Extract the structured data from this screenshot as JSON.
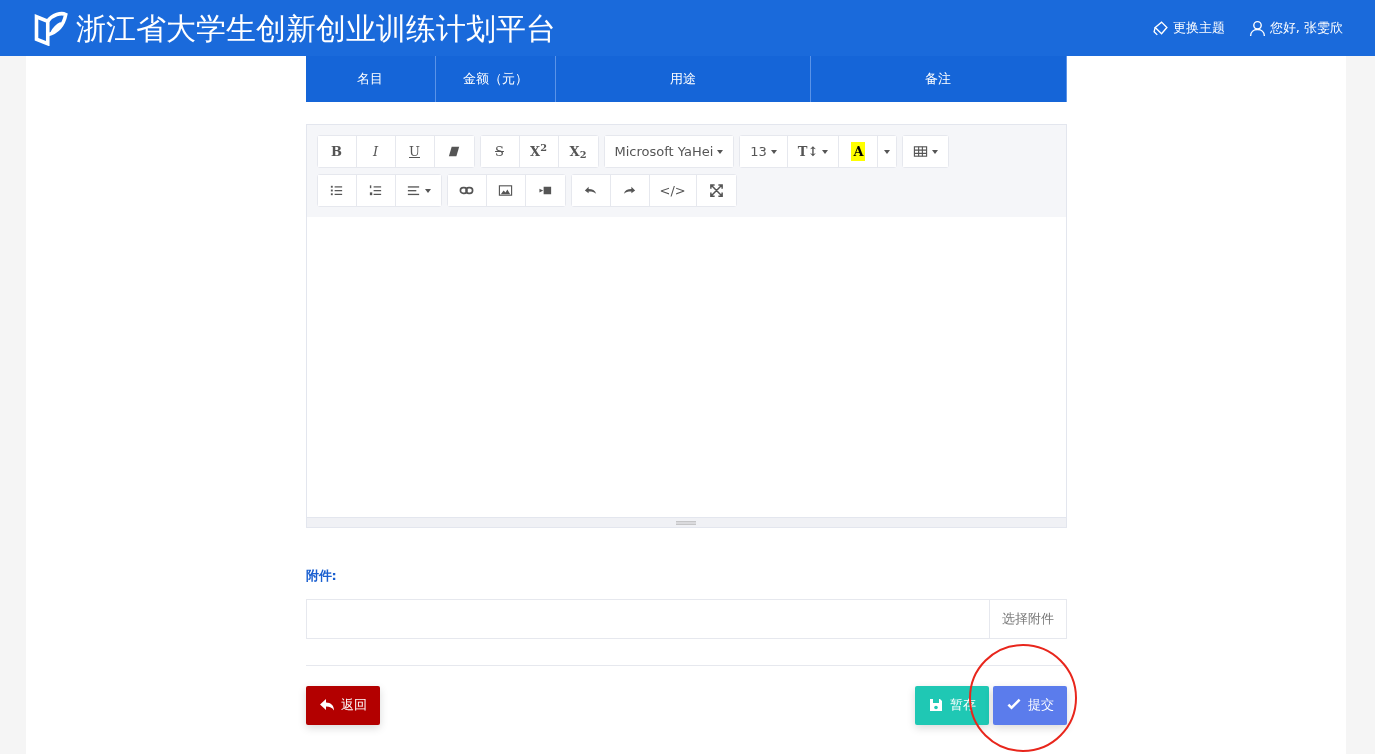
{
  "header": {
    "title": "浙江省大学生创新创业训练计划平台",
    "links": [
      {
        "kind": "theme",
        "label": "更换主题"
      },
      {
        "kind": "user",
        "label": "您好, 张雯欣"
      }
    ]
  },
  "table": {
    "columns": [
      "名目",
      "金额（元）",
      "用途",
      "备注"
    ]
  },
  "editor": {
    "toolbar": [
      [
        [
          {
            "kind": "bold",
            "label": "B"
          },
          {
            "kind": "italic",
            "label": "I"
          },
          {
            "kind": "underline",
            "label": "U"
          },
          {
            "kind": "eraser"
          }
        ],
        [
          {
            "kind": "strike",
            "label": "S"
          },
          {
            "kind": "superscript",
            "label": "X$^{2}$"
          },
          {
            "kind": "subscript",
            "label": "X$_{2}$"
          }
        ],
        [
          {
            "kind": "font",
            "label": "Microsoft YaHei"
          }
        ],
        [
          {
            "kind": "size",
            "label": "13"
          },
          {
            "kind": "lineheight",
            "label": "T↕"
          },
          {
            "kind": "highlight",
            "label": "A"
          },
          {
            "kind": "menu"
          }
        ],
        [
          {
            "kind": "table"
          }
        ]
      ],
      [
        [
          {
            "kind": "bullets"
          },
          {
            "kind": "numbering"
          },
          {
            "kind": "align"
          }
        ],
        [
          {
            "kind": "link"
          },
          {
            "kind": "image"
          },
          {
            "kind": "video"
          }
        ],
        [
          {
            "kind": "undo"
          },
          {
            "kind": "redo"
          },
          {
            "kind": "code",
            "label": "</>"
          },
          {
            "kind": "fullscreen"
          }
        ]
      ]
    ]
  },
  "attachment": {
    "label": "附件:",
    "button": "选择附件"
  },
  "buttons": [
    {
      "kind": "back",
      "label": "返回"
    },
    {
      "kind": "save",
      "label": "暂存"
    },
    {
      "kind": "submit",
      "label": "提交",
      "circled": true
    }
  ]
}
